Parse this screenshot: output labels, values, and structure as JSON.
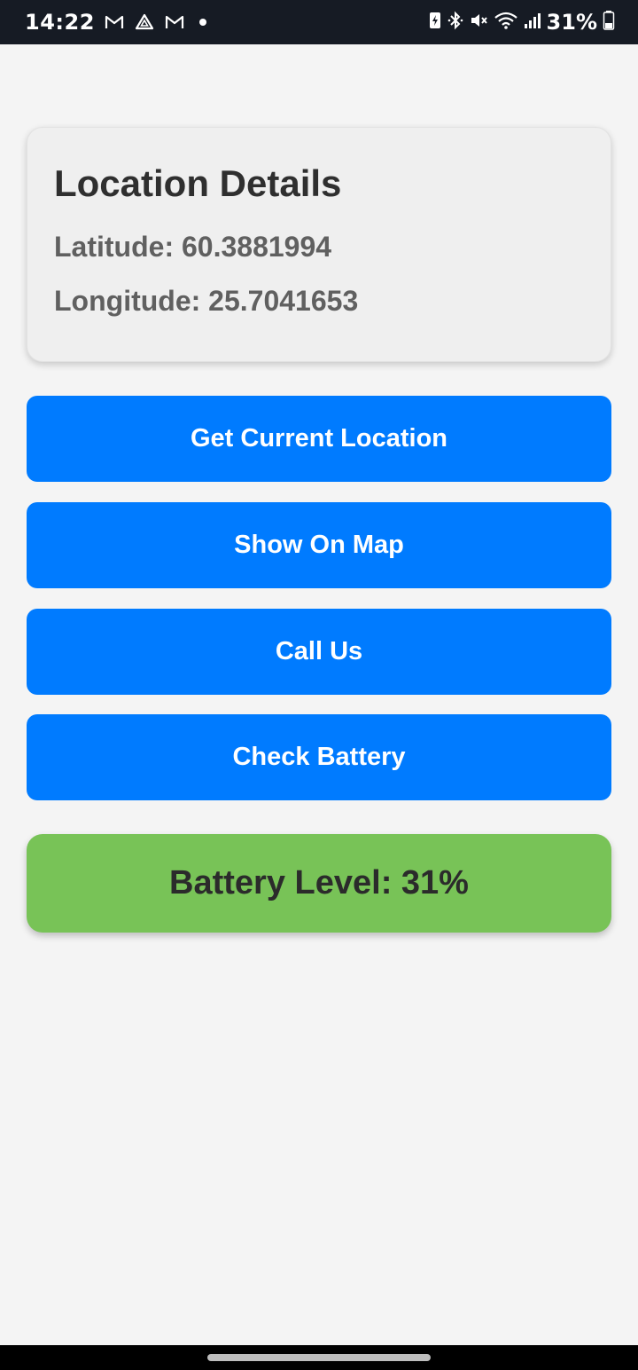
{
  "status_bar": {
    "time": "14:22",
    "battery_percent": "31%",
    "notification_icons": [
      "gmail-icon",
      "drive-icon",
      "gmail-icon"
    ],
    "system_icons": [
      "battery-saver-icon",
      "bluetooth-icon",
      "mute-icon",
      "wifi-icon",
      "signal-icon",
      "battery-icon"
    ]
  },
  "location_card": {
    "title": "Location Details",
    "latitude": "Latitude: 60.3881994",
    "longitude": "Longitude: 25.7041653"
  },
  "buttons": {
    "get_location": "Get Current Location",
    "show_map": "Show On Map",
    "call_us": "Call Us",
    "check_battery": "Check Battery"
  },
  "battery_result": {
    "text": "Battery Level: 31%",
    "level": 0.31
  },
  "colors": {
    "button": "#007bff",
    "battery_box": "#78c357",
    "status_bar": "#161b24",
    "background": "#f4f4f4"
  }
}
